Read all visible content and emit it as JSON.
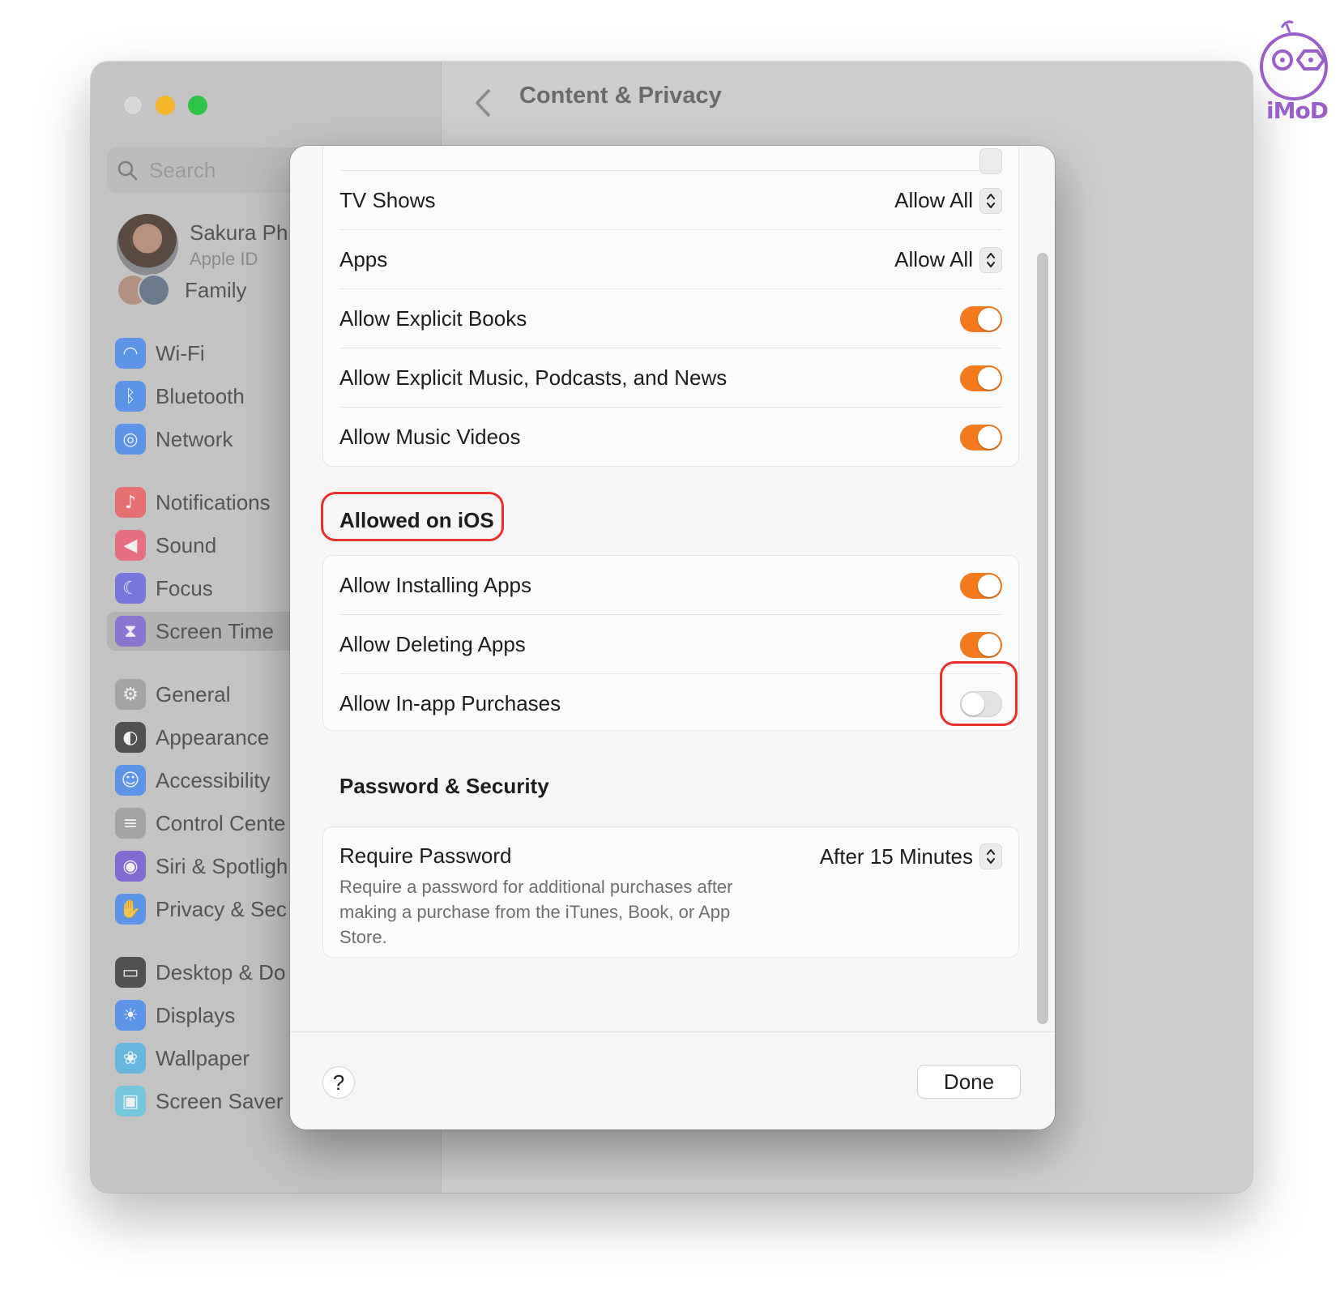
{
  "window": {
    "title": "Content & Privacy"
  },
  "sidebar": {
    "search_placeholder": "Search",
    "profile": {
      "name": "Sakura Ph",
      "subtitle": "Apple ID"
    },
    "family_label": "Family",
    "items": [
      {
        "label": "Wi-Fi",
        "icon": "wifi-icon",
        "color": "#3a86f5"
      },
      {
        "label": "Bluetooth",
        "icon": "bluetooth-icon",
        "color": "#3a86f5"
      },
      {
        "label": "Network",
        "icon": "globe-icon",
        "color": "#3a86f5"
      },
      {
        "label": "Notifications",
        "icon": "bell-icon",
        "color": "#f25555"
      },
      {
        "label": "Sound",
        "icon": "speaker-icon",
        "color": "#f2556d"
      },
      {
        "label": "Focus",
        "icon": "moon-icon",
        "color": "#5e5ce6"
      },
      {
        "label": "Screen Time",
        "icon": "hourglass-icon",
        "color": "#7b63d9"
      },
      {
        "label": "General",
        "icon": "gear-icon",
        "color": "#9a9a9a"
      },
      {
        "label": "Appearance",
        "icon": "appearance-icon",
        "color": "#2b2b2b"
      },
      {
        "label": "Accessibility",
        "icon": "accessibility-icon",
        "color": "#3a86f5"
      },
      {
        "label": "Control Cente",
        "icon": "control-center-icon",
        "color": "#9a9a9a"
      },
      {
        "label": "Siri & Spotligh",
        "icon": "siri-icon",
        "color": "#6a4fd6"
      },
      {
        "label": "Privacy & Sec",
        "icon": "hand-icon",
        "color": "#3a86f5"
      },
      {
        "label": "Desktop & Do",
        "icon": "desktop-icon",
        "color": "#2b2b2b"
      },
      {
        "label": "Displays",
        "icon": "sun-icon",
        "color": "#3a86f5"
      },
      {
        "label": "Wallpaper",
        "icon": "flower-icon",
        "color": "#4ab0e8"
      },
      {
        "label": "Screen Saver",
        "icon": "screensaver-icon",
        "color": "#5ac8e8"
      }
    ],
    "active_item": "Screen Time"
  },
  "sheet": {
    "media_rows": [
      {
        "label": "TV Shows",
        "value": "Allow All",
        "type": "stepper"
      },
      {
        "label": "Apps",
        "value": "Allow All",
        "type": "stepper"
      },
      {
        "label": "Allow Explicit Books",
        "type": "toggle",
        "on": true
      },
      {
        "label": "Allow Explicit Music, Podcasts, and News",
        "type": "toggle",
        "on": true
      },
      {
        "label": "Allow Music Videos",
        "type": "toggle",
        "on": true
      }
    ],
    "ios_section_title": "Allowed on iOS",
    "ios_rows": [
      {
        "label": "Allow Installing Apps",
        "type": "toggle",
        "on": true
      },
      {
        "label": "Allow Deleting Apps",
        "type": "toggle",
        "on": true
      },
      {
        "label": "Allow In-app Purchases",
        "type": "toggle",
        "on": false
      }
    ],
    "security_section_title": "Password & Security",
    "password": {
      "label": "Require Password",
      "value": "After 15 Minutes",
      "description": "Require a password for additional purchases after making a purchase from the iTunes, Book, or App Store."
    },
    "help_label": "?",
    "done_label": "Done"
  },
  "main": {
    "help_label": "?"
  },
  "watermark": {
    "text": "iMoD"
  },
  "colors": {
    "accent_orange": "#f47a1f",
    "highlight_red": "#e8302c"
  }
}
